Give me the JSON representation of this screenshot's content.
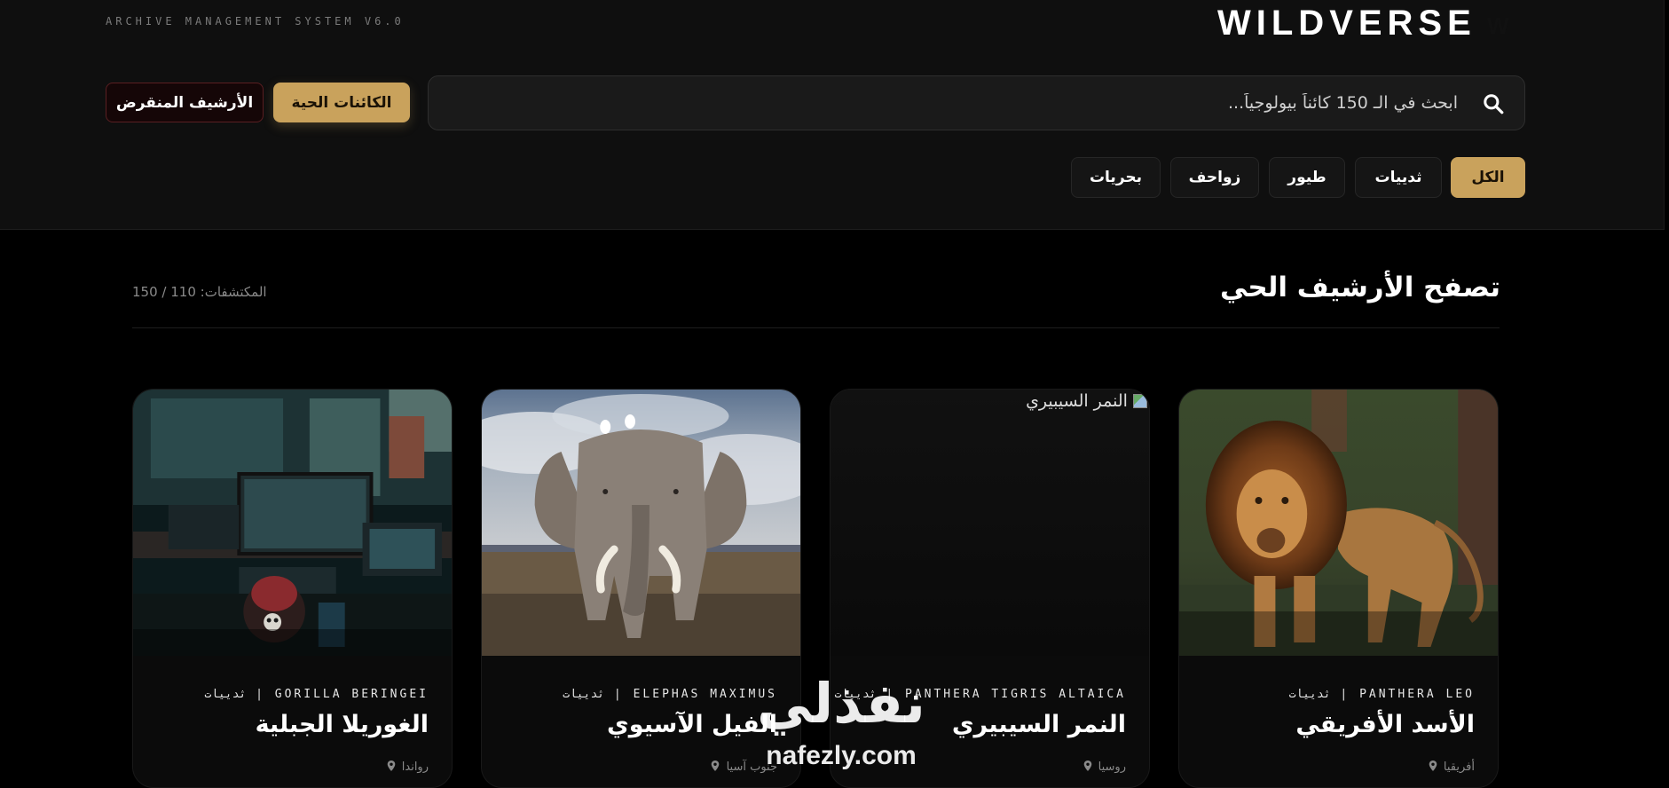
{
  "header": {
    "system_label": "ARCHIVE MANAGEMENT SYSTEM V6.0",
    "brand": "WILDVERSE",
    "brand_mark": "W",
    "buttons": {
      "living": "الكائنات الحية",
      "extinct": "الأرشيف المنقرض"
    },
    "search": {
      "placeholder": "ابحث في الـ 150 كائناً بيولوجياً...",
      "icon": "search-icon"
    },
    "filters": [
      {
        "label": "الكل",
        "active": true
      },
      {
        "label": "ثدييات",
        "active": false
      },
      {
        "label": "طيور",
        "active": false
      },
      {
        "label": "زواحف",
        "active": false
      },
      {
        "label": "بحريات",
        "active": false
      }
    ]
  },
  "main": {
    "title": "تصفح الأرشيف الحي",
    "found": "المكتشفات: 110 / 150",
    "cards": [
      {
        "meta": "PANTHERA LEO | ثدييات",
        "name": "الأسد الأفريقي",
        "location": "أفريقيا",
        "image": "lion"
      },
      {
        "meta": "PANTHERA TIGRIS ALTAICA | ثدييات",
        "name": "النمر السيبيري",
        "location": "روسيا",
        "image": "broken",
        "image_alt": "النمر السيبيري"
      },
      {
        "meta": "ELEPHAS MAXIMUS | ثدييات",
        "name": "الفيل الآسيوي",
        "location": "جنوب آسيا",
        "image": "elephant"
      },
      {
        "meta": "GORILLA BERINGEI | ثدييات",
        "name": "الغوريلا الجبلية",
        "location": "رواندا",
        "image": "computer-room"
      }
    ]
  },
  "watermark": {
    "arabic": "نفذلي",
    "latin": "nafezly.com"
  },
  "colors": {
    "accent": "#c9a25c",
    "background": "#000000",
    "header_bg": "#0f0f0f",
    "extinct_border": "#5a1f22"
  }
}
